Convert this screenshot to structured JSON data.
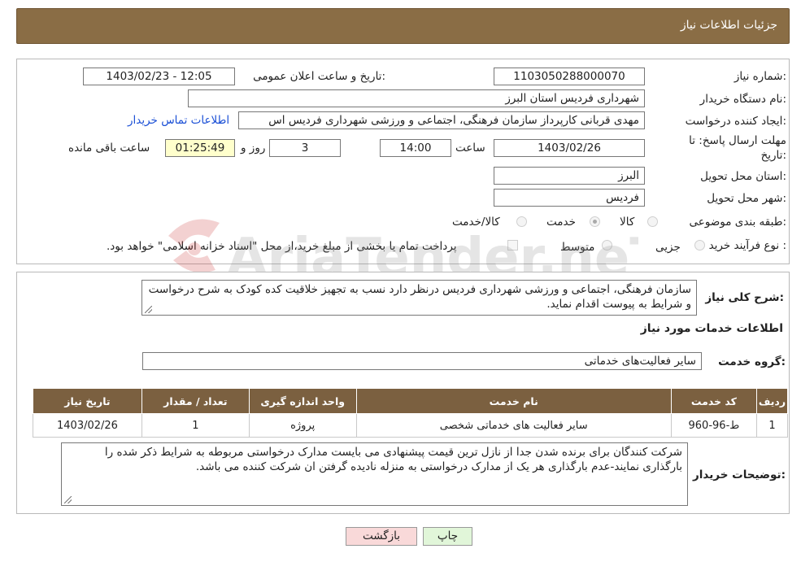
{
  "header": {
    "title": "جزئیات اطلاعات نیاز"
  },
  "form": {
    "need_number": {
      "label": "شماره نیاز:",
      "value": "1103050288000070"
    },
    "announce": {
      "label": "تاریخ و ساعت اعلان عمومی:",
      "value": "1403/02/23 - 12:05"
    },
    "buyer_org": {
      "label": "نام دستگاه خریدار:",
      "value": "شهرداری فردیس استان البرز"
    },
    "requester": {
      "label": "ایجاد کننده درخواست:",
      "value": "مهدی قربانی کارپرداز سازمان فرهنگی، اجتماعی و ورزشی شهرداری فردیس اس",
      "contact_link": "اطلاعات تماس خریدار"
    },
    "deadline": {
      "label_line1": "مهلت ارسال پاسخ: تا",
      "label_line2": "تاریخ:",
      "date": "1403/02/26",
      "time_label": "ساعت",
      "time": "14:00",
      "days": "3",
      "days_label": "روز و",
      "remaining": "01:25:49",
      "remaining_label": "ساعت باقی مانده"
    },
    "province": {
      "label": "استان محل تحویل:",
      "value": "البرز"
    },
    "city": {
      "label": "شهر محل تحویل:",
      "value": "فردیس"
    },
    "category": {
      "label": "طبقه بندی موضوعی:",
      "options": [
        "کالا",
        "خدمت",
        "کالا/خدمت"
      ],
      "selected": "خدمت"
    },
    "purchase": {
      "label": "نوع فرآیند خرید :",
      "options": [
        "جزیی",
        "متوسط"
      ],
      "payment_note": "پرداخت تمام یا بخشی از مبلغ خرید،از محل \"اسناد خزانه اسلامی\" خواهد بود."
    }
  },
  "summary": {
    "label": "شرح کلی نیاز:",
    "text": "سازمان فرهنگی، اجتماعی و ورزشی شهرداری فردیس درنظر دارد نسب به تجهیز خلاقیت کده کودک به شرح درخواست و شرایط به پیوست اقدام نماید."
  },
  "services": {
    "title": "اطلاعات خدمات مورد نیاز",
    "group_label": "گروه خدمت:",
    "group_value": "سایر فعالیت‌های خدماتی",
    "table": {
      "headers": [
        "ردیف",
        "کد خدمت",
        "نام خدمت",
        "واحد اندازه گیری",
        "تعداد / مقدار",
        "تاریخ نیاز"
      ],
      "rows": [
        [
          "1",
          "ط-96-960",
          "سایر فعالیت های خدماتی شخصی",
          "پروژه",
          "1",
          "1403/02/26"
        ]
      ]
    }
  },
  "buyer_notes": {
    "label": "توضیحات خریدار:",
    "text": "شرکت کنندگان برای برنده شدن جدا از نازل ترین قیمت پیشنهادی می بایست مدارک درخواستی مربوطه به شرایط ذکر شده را بارگذاری نمایند-عدم بارگذاری هر یک از مدارک درخواستی به منزله نادیده گرفتن ان شرکت کننده می باشد."
  },
  "buttons": {
    "print": "چاپ",
    "back": "بازگشت"
  },
  "colors": {
    "header_bg": "#8a6d45",
    "table_header_bg": "#7b6040",
    "link": "#1a4fd6",
    "back_button_bg": "#f9d9d9",
    "print_button_bg": "#e1f6d9"
  },
  "watermark": "AriaTender.neT"
}
